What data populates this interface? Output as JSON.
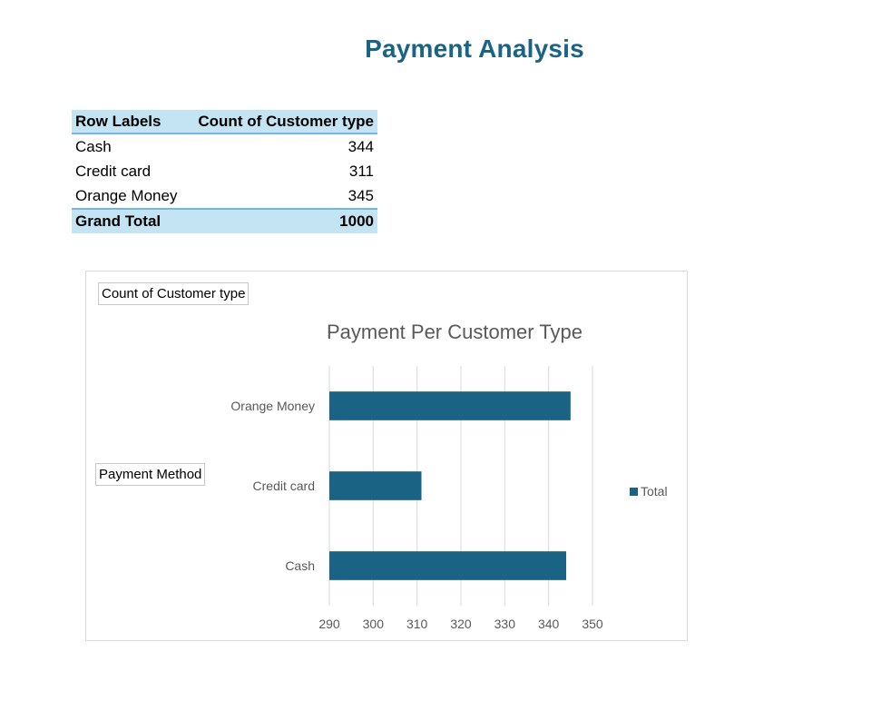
{
  "page": {
    "title": "Payment Analysis"
  },
  "pivot": {
    "header": {
      "row_label": "Row Labels",
      "value_label": "Count of Customer type"
    },
    "rows": [
      {
        "label": "Cash",
        "value": "344"
      },
      {
        "label": "Credit card",
        "value": "311"
      },
      {
        "label": "Orange Money",
        "value": "345"
      }
    ],
    "total": {
      "label": "Grand Total",
      "value": "1000"
    }
  },
  "chart_buttons": {
    "value_field": "Count of Customer type",
    "axis_field": "Payment Method"
  },
  "chart_data": {
    "type": "bar",
    "orientation": "horizontal",
    "title": "Payment Per Customer Type",
    "categories": [
      "Cash",
      "Credit card",
      "Orange Money"
    ],
    "series": [
      {
        "name": "Total",
        "values": [
          344,
          311,
          345
        ],
        "color": "#1b6385"
      }
    ],
    "xlim": [
      290,
      350
    ],
    "xticks": [
      290,
      300,
      310,
      320,
      330,
      340,
      350
    ],
    "grid": true,
    "legend": "right"
  },
  "colors": {
    "accent": "#1b6385",
    "pivot_header_bg": "#c5e4f3",
    "pivot_border": "#70b8df",
    "gridline": "#d9d9d9",
    "axis_text": "#595959"
  }
}
